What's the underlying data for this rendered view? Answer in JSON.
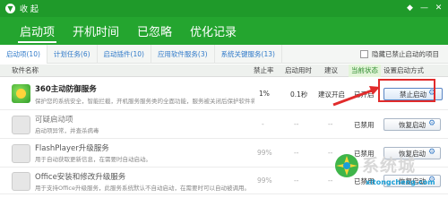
{
  "titlebar": {
    "back_label": "收 起",
    "controls": [
      "◆",
      "—",
      "✕"
    ]
  },
  "tabs": [
    {
      "label": "启动项",
      "active": true
    },
    {
      "label": "开机时间",
      "active": false
    },
    {
      "label": "已忽略",
      "active": false
    },
    {
      "label": "优化记录",
      "active": false
    }
  ],
  "filters": {
    "items": [
      {
        "label": "启动项(10)",
        "active": true
      },
      {
        "label": "计划任务(6)",
        "active": false
      },
      {
        "label": "启动插件(10)",
        "active": false
      },
      {
        "label": "应用软件服务(3)",
        "active": false
      },
      {
        "label": "系统关键服务(13)",
        "active": false
      }
    ],
    "hide_label": "隐藏已禁止启动的项目"
  },
  "table": {
    "headers": {
      "name": "软件名称",
      "disable_rate": "禁止率",
      "boot_time": "启动用时",
      "suggest": "建议",
      "status": "当前状态",
      "action": "设置启动方式"
    },
    "rows": [
      {
        "name": "360主动防御服务",
        "desc": "保护您的系统安全，智能拦截，开机服务服务类的全面功能，服务被关闭后保护软件将无法正…",
        "disable_rate": "1%",
        "boot_time": "0.1秒",
        "suggest": "建议开启",
        "status": "已开启",
        "button": "禁止启动"
      },
      {
        "name": "可疑启动项",
        "desc": "启动项异常，并查杀病毒",
        "disable_rate": "-",
        "boot_time": "--",
        "suggest": "--",
        "status": "已禁用",
        "button": "恢复启动"
      },
      {
        "name": "FlashPlayer升级服务",
        "desc": "用于自动获取更新信息，在需要时自动启动。",
        "disable_rate": "99%",
        "boot_time": "--",
        "suggest": "--",
        "status": "已禁用",
        "button": "恢复启动"
      },
      {
        "name": "Office安装和修改升级服务",
        "desc": "用于支持Office升级服务，此服务系统默认不自动启动，在需要时可以自动被调用。",
        "disable_rate": "99%",
        "boot_time": "--",
        "suggest": "--",
        "status": "已禁用",
        "button": "恢复启动"
      }
    ]
  },
  "watermark": {
    "cn": "系统城",
    "url": "xitongcheng.com"
  },
  "colors": {
    "brand_green": "#24a52f",
    "link_blue": "#2f79c9",
    "highlight_red": "#e12b2b"
  }
}
